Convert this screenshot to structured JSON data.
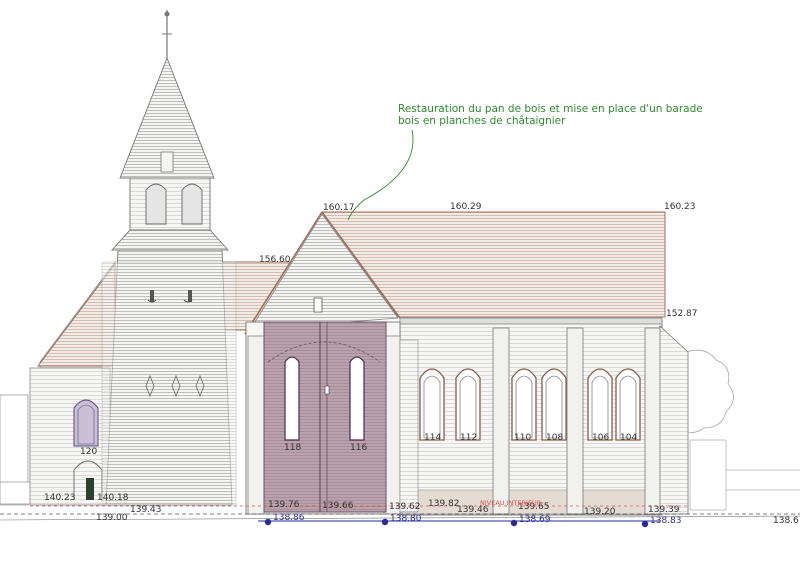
{
  "annotation": {
    "line1": "Restauration du pan de bois et mise en place d'un barade",
    "line2": "bois en planches de châtaignier"
  },
  "levels": {
    "gable_top": "160.17",
    "ridge_mid": "160.29",
    "ridge_right": "160.23",
    "eave_left": "156.60",
    "eave_right": "152.87",
    "tower_base_left": "140.23",
    "tower_base_right": "140.18",
    "tower_ground": "139.43",
    "ground_left": "139.00",
    "nave_floor_1": "139.76",
    "nave_floor_2": "139.66",
    "nave_floor_3": "139.62",
    "nave_floor_4": "139.82",
    "nave_floor_5": "139.46",
    "nave_floor_6": "139.65",
    "nave_floor_7": "139.20",
    "nave_floor_8": "139.39",
    "ground_right": "138.6",
    "grade_1": "138.86",
    "grade_2": "138.80",
    "grade_3": "138.69",
    "grade_4": "138.83"
  },
  "windows": {
    "w120": "120",
    "w118": "118",
    "w116": "116",
    "w114": "114",
    "w112": "112",
    "w110": "110",
    "w108": "108",
    "w106": "106",
    "w104": "104"
  },
  "floor_label": "NIVEAU INTERIEUR"
}
